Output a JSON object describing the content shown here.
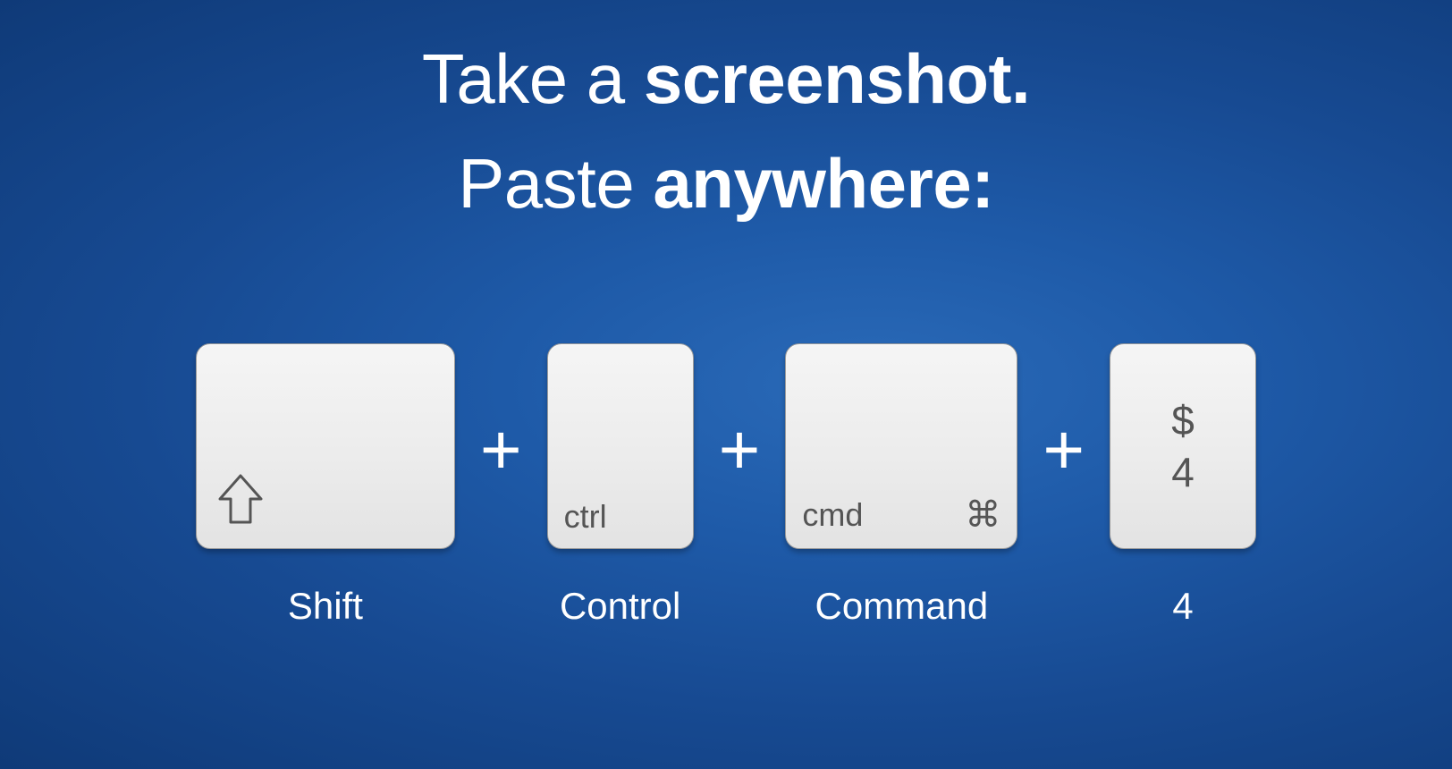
{
  "heading": {
    "line1_prefix": "Take a ",
    "line1_bold": "screenshot.",
    "line2_prefix": "Paste ",
    "line2_bold": "anywhere:"
  },
  "separator": "+",
  "keys": {
    "shift": {
      "caption": "Shift"
    },
    "ctrl": {
      "key_label": "ctrl",
      "caption": "Control"
    },
    "cmd": {
      "key_label": "cmd",
      "key_symbol": "⌘",
      "caption": "Command"
    },
    "four": {
      "top": "$",
      "bottom": "4",
      "caption": "4"
    }
  }
}
